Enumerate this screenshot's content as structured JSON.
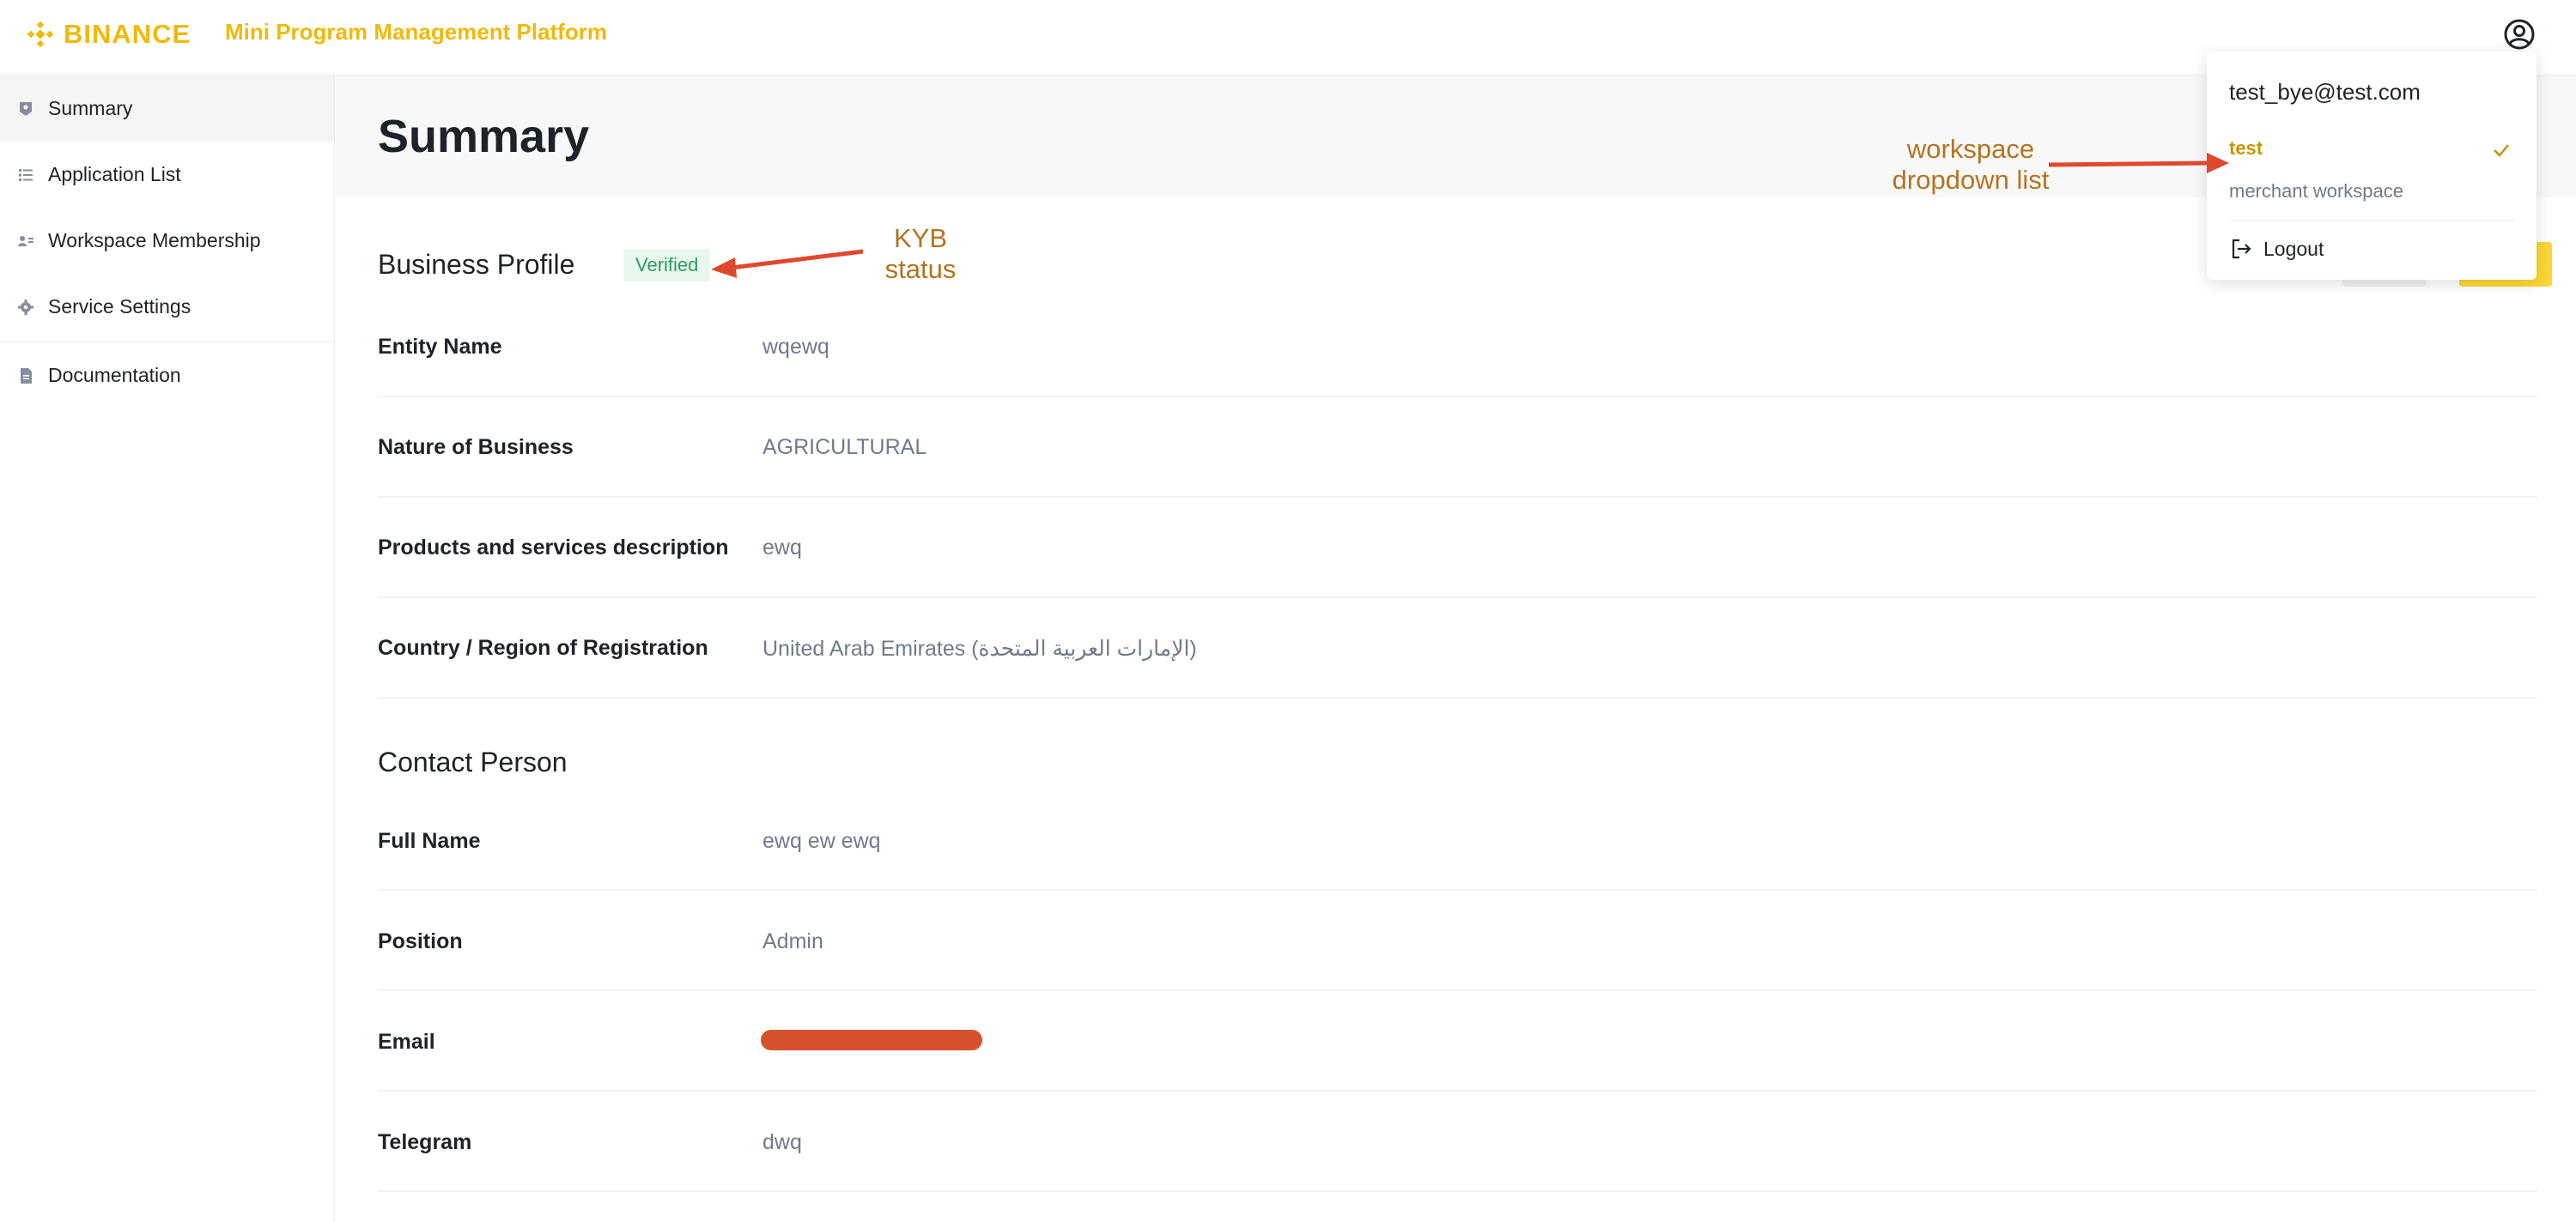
{
  "header": {
    "logo_text": "BINANCE",
    "platform_title": "Mini Program Management Platform"
  },
  "sidebar": {
    "items": [
      {
        "label": "Summary",
        "icon": "badge-icon",
        "active": true
      },
      {
        "label": "Application List",
        "icon": "list-icon"
      },
      {
        "label": "Workspace Membership",
        "icon": "members-icon"
      },
      {
        "label": "Service Settings",
        "icon": "gear-icon"
      },
      {
        "label": "Documentation",
        "icon": "document-icon"
      }
    ]
  },
  "page": {
    "title": "Summary"
  },
  "business_profile": {
    "title": "Business Profile",
    "status": "Verified",
    "fields": [
      {
        "label": "Entity Name",
        "value": "wqewq"
      },
      {
        "label": "Nature of Business",
        "value": "AGRICULTURAL"
      },
      {
        "label": "Products and services description",
        "value": "ewq"
      },
      {
        "label": "Country / Region of Registration",
        "value": "United Arab Emirates (الإمارات العربية المتحدة)"
      }
    ]
  },
  "contact_person": {
    "title": "Contact Person",
    "fields": [
      {
        "label": "Full Name",
        "value": "ewq ew ewq"
      },
      {
        "label": "Position",
        "value": "Admin"
      },
      {
        "label": "Email",
        "value": ""
      },
      {
        "label": "Telegram",
        "value": "dwq"
      }
    ]
  },
  "dropdown": {
    "email": "test_bye@test.com",
    "workspaces": [
      {
        "name": "test",
        "selected": true
      },
      {
        "name": "merchant workspace",
        "selected": false
      }
    ],
    "logout_label": "Logout"
  },
  "annotations": {
    "kyb_line1": "KYB",
    "kyb_line2": "status",
    "workspace_line1": "workspace",
    "workspace_line2": "dropdown list"
  },
  "colors": {
    "brand": "#f0b90b",
    "verified_bg": "#e9f8ef",
    "verified_text": "#2b9b5b",
    "annotation": "#b5731f",
    "arrow": "#e0482d"
  }
}
